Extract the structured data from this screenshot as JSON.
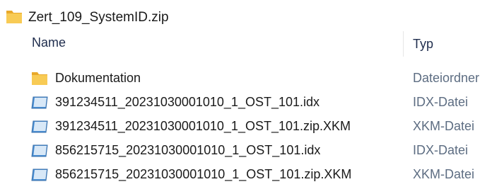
{
  "window": {
    "title": "Zert_109_SystemID.zip",
    "title_icon": "zip-folder-icon"
  },
  "columns": {
    "name": "Name",
    "type": "Typ"
  },
  "rows": [
    {
      "name": "Dokumentation",
      "type": "Dateiordner",
      "icon": "folder-icon"
    },
    {
      "name": "391234511_20231030001010_1_OST_101.idx",
      "type": "IDX-Datei",
      "icon": "file-icon"
    },
    {
      "name": "391234511_20231030001010_1_OST_101.zip.XKM",
      "type": "XKM-Datei",
      "icon": "file-icon"
    },
    {
      "name": "856215715_20231030001010_1_OST_101.idx",
      "type": "IDX-Datei",
      "icon": "file-icon"
    },
    {
      "name": "856215715_20231030001010_1_OST_101.zip.XKM",
      "type": "XKM-Datei",
      "icon": "file-icon"
    }
  ],
  "colors": {
    "folder": "#f8cb55",
    "folder_tab": "#e9a92a",
    "file_icon": "#4a8fd4",
    "type_text": "#5d6d82"
  }
}
